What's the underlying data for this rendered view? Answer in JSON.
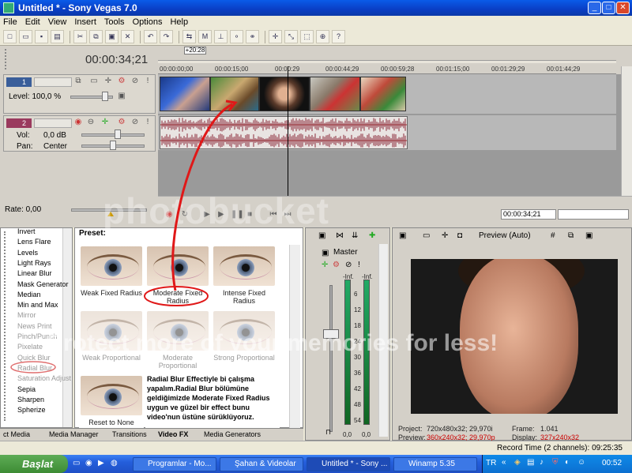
{
  "window": {
    "title": "Untitled * - Sony Vegas 7.0"
  },
  "menu": [
    "File",
    "Edit",
    "View",
    "Insert",
    "Tools",
    "Options",
    "Help"
  ],
  "timecode": "00:00:34;21",
  "ruler_marker": "+20:28",
  "ruler_ticks": [
    "00:00:00;00",
    "00:00:15;00",
    "00:00:29",
    "00:00:44;29",
    "00:00:59;28",
    "00:01:15;00",
    "00:01:29;29",
    "00:01:44;29"
  ],
  "video_track": {
    "num": "1",
    "level": "Level: 100,0 %"
  },
  "audio_track": {
    "num": "2",
    "vol_label": "Vol:",
    "vol_value": "0,0 dB",
    "pan_label": "Pan:",
    "pan_value": "Center"
  },
  "rate": "Rate: 0,00",
  "transport_time": "00:00:34;21",
  "fx": {
    "preset_label": "Preset:",
    "items": [
      {
        "label": "Invert",
        "dim": false
      },
      {
        "label": "Lens Flare",
        "dim": false
      },
      {
        "label": "Levels",
        "dim": false
      },
      {
        "label": "Light Rays",
        "dim": false
      },
      {
        "label": "Linear Blur",
        "dim": false
      },
      {
        "label": "Mask Generator",
        "dim": false
      },
      {
        "label": "Median",
        "dim": false
      },
      {
        "label": "Min and Max",
        "dim": false
      },
      {
        "label": "Mirror",
        "dim": true
      },
      {
        "label": "News Print",
        "dim": true
      },
      {
        "label": "Pinch/Punch",
        "dim": true
      },
      {
        "label": "Pixelate",
        "dim": true
      },
      {
        "label": "Quick Blur",
        "dim": true
      },
      {
        "label": "Radial Blur",
        "dim": true
      },
      {
        "label": "Saturation Adjust",
        "dim": true
      },
      {
        "label": "Sepia",
        "dim": false
      },
      {
        "label": "Sharpen",
        "dim": false
      },
      {
        "label": "Spherize",
        "dim": false
      }
    ],
    "presets": [
      {
        "label": "Weak Fixed Radius",
        "pale": false
      },
      {
        "label": "Moderate Fixed Radius",
        "pale": false
      },
      {
        "label": "Intense Fixed Radius",
        "pale": false
      },
      {
        "label": "Weak Proportional",
        "pale": true
      },
      {
        "label": "Moderate Proportional",
        "pale": true
      },
      {
        "label": "Strong Proportional",
        "pale": true
      },
      {
        "label": "Reset to None",
        "pale": false
      }
    ],
    "note": "Radial Blur Effectiyle bi çalışma yapalım.Radial Blur bölümüne geldiğimizde Moderate Fixed Radius uygun ve güzel bir effect bunu video'nun üstüne sürüklüyoruz."
  },
  "tabs": [
    "ct Media",
    "Media Manager",
    "Transitions",
    "Video FX",
    "Media Generators"
  ],
  "active_tab": "Video FX",
  "mixer": {
    "master": "Master",
    "left_inf": "-Inf.",
    "right_inf": "-Inf.",
    "scale": [
      "6",
      "12",
      "18",
      "24",
      "30",
      "36",
      "42",
      "48",
      "54"
    ],
    "left_db": "0,0",
    "right_db": "0,0"
  },
  "preview": {
    "mode": "Preview (Auto)",
    "project_label": "Project:",
    "project_value": "720x480x32; 29,970i",
    "preview_label": "Preview:",
    "preview_value": "360x240x32; 29,970p",
    "frame_label": "Frame:",
    "frame_value": "1.041",
    "display_label": "Display:",
    "display_value": "327x240x32"
  },
  "status": "Record Time (2 channels): 09:25:35",
  "watermark": "photobucket",
  "watermark2": "Protect more of your memories for less!",
  "taskbar": {
    "start": "Başlat",
    "tasks": [
      {
        "label": "Programlar - Mo..."
      },
      {
        "label": "Şahan & Videolar"
      },
      {
        "label": "Untitled * - Sony ..."
      },
      {
        "label": "Winamp 5.35"
      }
    ],
    "lang": "TR",
    "clock": "00:52"
  }
}
